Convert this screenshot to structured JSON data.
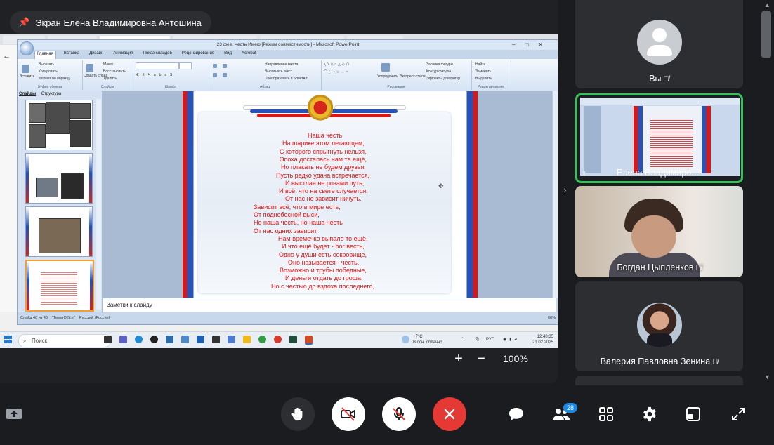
{
  "screen_share": {
    "label": "Экран Елена Владимировна Антошина",
    "powerpoint": {
      "title": "23 фев. Честь Имею [Режим совместимости] - Microsoft PowerPoint",
      "tabs": [
        "Главная",
        "Вставка",
        "Дизайн",
        "Анимация",
        "Показ слайдов",
        "Рецензирование",
        "Вид",
        "Acrobat"
      ],
      "ribbon": {
        "clipboard": {
          "label": "Буфер обмена",
          "paste": "Вставить",
          "cut": "Вырезать",
          "copy": "Копировать",
          "format": "Формат по образцу"
        },
        "slides": {
          "label": "Слайды",
          "new": "Создать слайд",
          "layout": "Макет",
          "reset": "Восстановить",
          "delete": "Удалить"
        },
        "font": {
          "label": "Шрифт"
        },
        "paragraph": {
          "label": "Абзац",
          "direction": "Направление текста",
          "align": "Выровнять текст",
          "smartart": "Преобразовать в SmartArt"
        },
        "drawing": {
          "label": "Рисование",
          "arrange": "Упорядочить",
          "quick_styles": "Экспресс-стили",
          "fill": "Заливка фигуры",
          "outline": "Контур фигуры",
          "effects": "Эффекты для фигур"
        },
        "editing": {
          "label": "Редактирование",
          "find": "Найти",
          "replace": "Заменить",
          "select": "Выделить"
        }
      },
      "panel_tabs": [
        "Слайды",
        "Структура"
      ],
      "thumbnails": [
        "37",
        "38",
        "39",
        "40"
      ],
      "poem_lines": [
        "Наша честь",
        "На шарике этом летающем,",
        "С которого спрыгнуть нельзя,",
        "Эпоха досталась нам та ещё,",
        "Но плакать не будем друзья.",
        "Пусть редко удача встречается,",
        "И выстлан не розами путь,",
        "И всё, что на свете случается,",
        "От нас не зависит ничуть.",
        "Зависит всё, что в мире есть,",
        "От поднебесной выси,",
        "Но наша честь, но наша честь",
        "От нас одних зависит.",
        "Нам времечко выпало то ещё,",
        "И что ещё будет - бог весть,",
        "Одно у души есть сокровище,",
        "Оно называется - честь.",
        "Возможно и трубы победные,",
        "И деньги отдать до гроша,",
        "Но с честью до вздоха последнего,"
      ],
      "notes_placeholder": "Заметки к слайду",
      "status": {
        "slide": "Слайд 40 из 40",
        "theme": "\"Тема Office\"",
        "lang": "Русский (Россия)",
        "zoom": "66%"
      }
    },
    "taskbar": {
      "search": "Поиск",
      "weather_temp": "+7°C",
      "weather_desc": "В осн. облачно",
      "lang": "РУС",
      "time": "12:48:35",
      "date": "21.02.2025"
    },
    "zoom_label": "100%"
  },
  "participants": [
    {
      "name": "Вы",
      "muted": true
    },
    {
      "name": "Елена Владимиро...",
      "muted": false
    },
    {
      "name": "Богдан Цыпленков",
      "muted": true
    },
    {
      "name": "Валерия Павловна Зенина",
      "muted": true
    }
  ],
  "toolbar": {
    "participants_count": "28"
  },
  "colors": {
    "active_speaker_border": "#36c25a",
    "end_call": "#e53935",
    "badge": "#1e88e5",
    "poem_text": "#e01515"
  }
}
